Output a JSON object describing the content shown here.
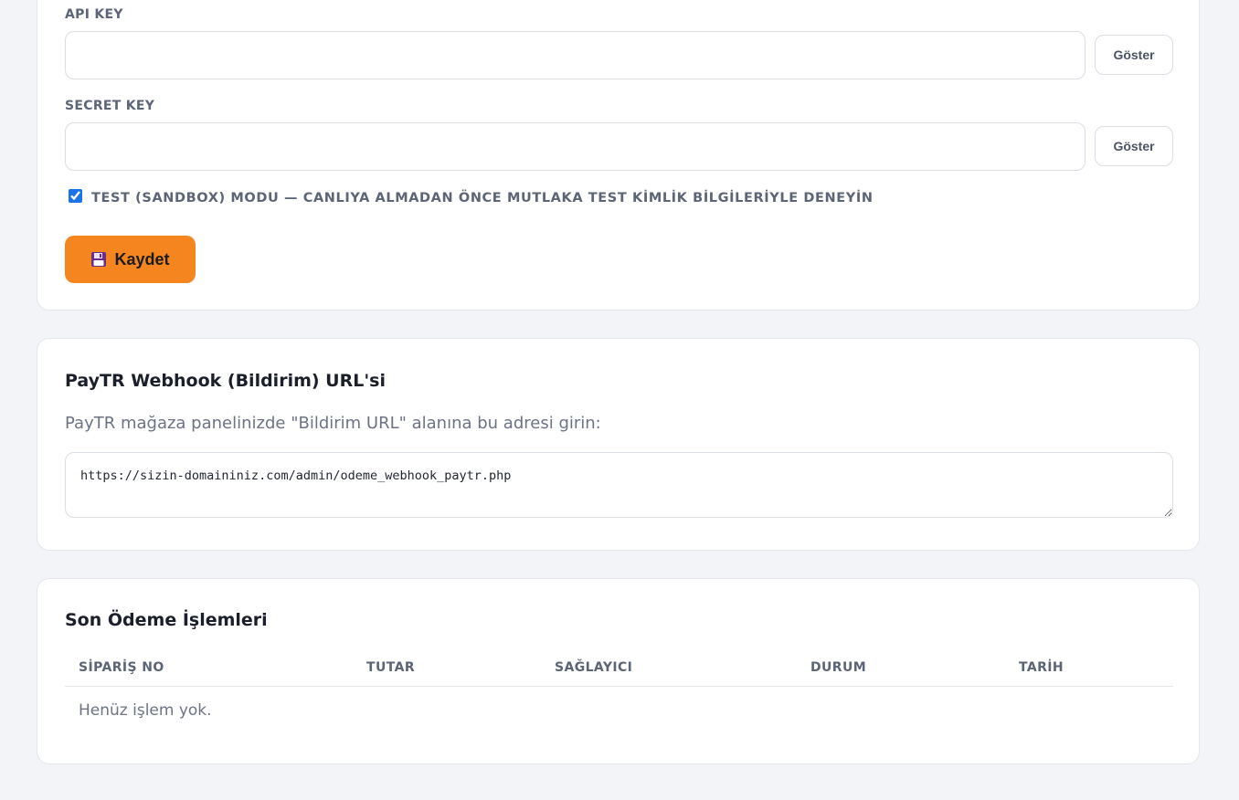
{
  "credentials": {
    "api_key_label": "API KEY",
    "api_key_value": "",
    "secret_key_label": "SECRET KEY",
    "secret_key_value": "",
    "show_button_label": "Göster",
    "sandbox_checked": true,
    "sandbox_label": "TEST (SANDBOX) MODU — CANLIYA ALMADAN ÖNCE MUTLAKA TEST KİMLİK BİLGİLERİYLE DENEYİN",
    "save_button_label": "Kaydet",
    "save_button_icon": "floppy-disk-icon"
  },
  "webhook": {
    "title": "PayTR Webhook (Bildirim) URL'si",
    "description": "PayTR mağaza panelinizde \"Bildirim URL\" alanına bu adresi girin:",
    "url": "https://sizin-domaininiz.com/admin/odeme_webhook_paytr.php"
  },
  "transactions": {
    "title": "Son Ödeme İşlemleri",
    "columns": [
      "SİPARİŞ NO",
      "TUTAR",
      "SAĞLAYICI",
      "DURUM",
      "TARİH"
    ],
    "empty_message": "Henüz işlem yok."
  },
  "colors": {
    "accent": "#f5861f",
    "page_background": "#f3f4f7",
    "checkbox": "#1a73e8"
  }
}
